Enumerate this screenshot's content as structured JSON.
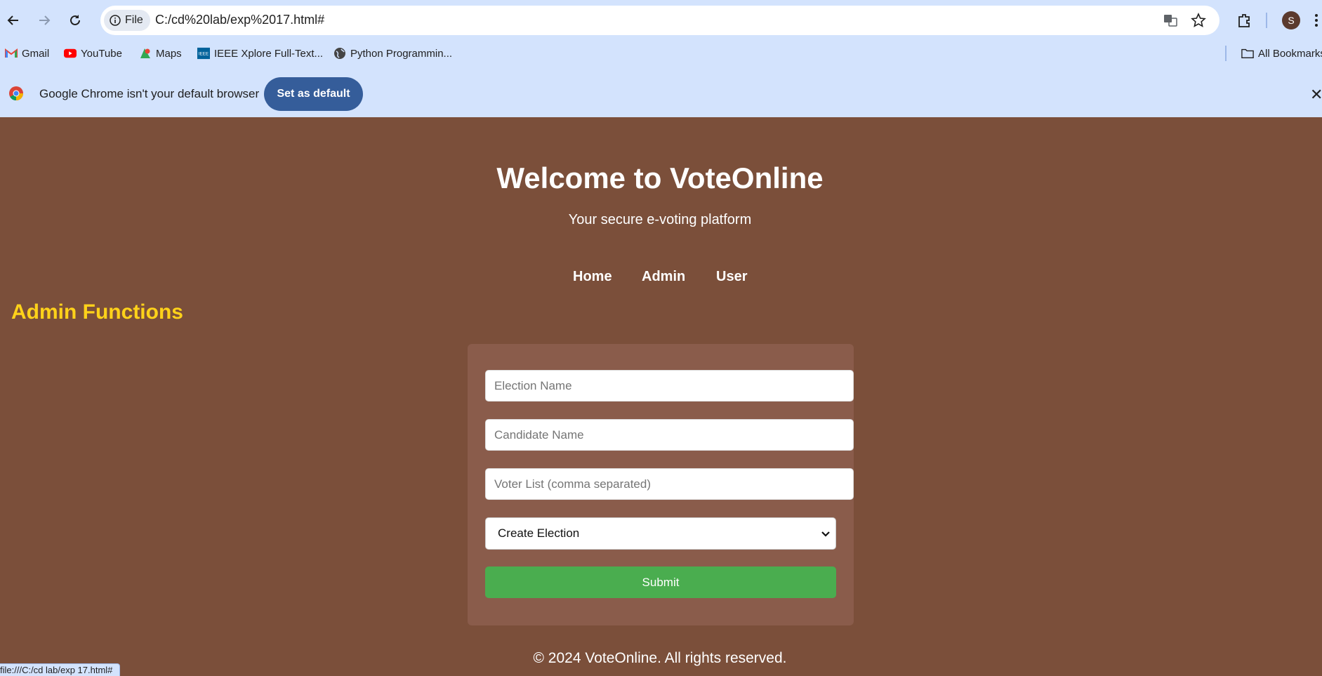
{
  "browser": {
    "url_chip": "File",
    "url": "C:/cd%20lab/exp%2017.html#",
    "profile_initial": "S",
    "bookmarks": [
      {
        "label": "Gmail",
        "icon": "gmail-icon"
      },
      {
        "label": "YouTube",
        "icon": "youtube-icon"
      },
      {
        "label": "Maps",
        "icon": "maps-icon"
      },
      {
        "label": "IEEE Xplore Full-Text...",
        "icon": "ieee-icon"
      },
      {
        "label": "Python Programmin...",
        "icon": "globe-icon"
      }
    ],
    "all_bookmarks": "All Bookmarks",
    "infobar_text": "Google Chrome isn't your default browser",
    "infobar_button": "Set as default",
    "status_url": "file:///C:/cd lab/exp 17.html#"
  },
  "page": {
    "title": "Welcome to VoteOnline",
    "subtitle": "Your secure e-voting platform",
    "nav": [
      "Home",
      "Admin",
      "User"
    ],
    "section_title": "Admin Functions",
    "form": {
      "election_placeholder": "Election Name",
      "candidate_placeholder": "Candidate Name",
      "voters_placeholder": "Voter List (comma separated)",
      "action_selected": "Create Election",
      "submit_label": "Submit"
    },
    "footer": "© 2024 VoteOnline. All rights reserved."
  },
  "colors": {
    "background": "#7b4f3a",
    "card": "#8a5c4b",
    "accent_title": "#ffd21a",
    "submit": "#4aad4f",
    "chrome": "#d3e3fd",
    "set_default": "#355d9a"
  }
}
